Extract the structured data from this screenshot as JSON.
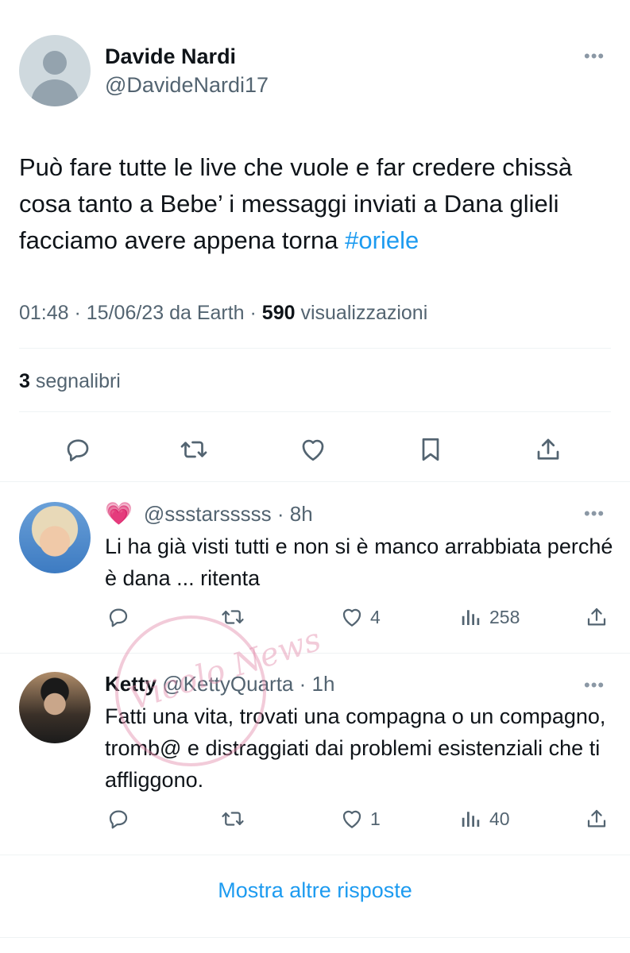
{
  "main_tweet": {
    "author_name": "Davide Nardi",
    "author_handle": "@DavideNardi17",
    "text_before": "Può fare tutte le live che vuole e far credere chissà cosa tanto a Bebe’ i messaggi inviati a Dana glieli facciamo avere appena torna ",
    "hashtag": "#oriele",
    "time": "01:48",
    "date": "15/06/23",
    "source": "da Earth",
    "views_count": "590",
    "views_label": "visualizzazioni",
    "bookmarks_count": "3",
    "bookmarks_label": "segnalibri",
    "more_label": "•••"
  },
  "replies": [
    {
      "emoji": "💗",
      "author_name": "",
      "handle": "@ssstarsssss",
      "time": "8h",
      "text": "Li ha già visti tutti e non si è manco arrabbiata perché è dana ... ritenta",
      "likes": "4",
      "views": "258"
    },
    {
      "author_name": "Ketty",
      "handle": "@KettyQuarta",
      "time": "1h",
      "text": "Fatti una vita, trovati una compagna o un compagno, tromb@ e distraggiati dai problemi esistenziali che ti affliggono.",
      "likes": "1",
      "views": "40"
    }
  ],
  "show_more_label": "Mostra altre risposte",
  "watermark_text": "Vicolo News",
  "icons": {
    "reply": "reply-icon",
    "retweet": "retweet-icon",
    "like": "heart-icon",
    "bookmark": "bookmark-icon",
    "share": "share-icon",
    "views": "views-icon"
  },
  "colors": {
    "link": "#1d9bf0",
    "text": "#0f1419",
    "muted": "#536471",
    "divider": "#eff3f4"
  }
}
